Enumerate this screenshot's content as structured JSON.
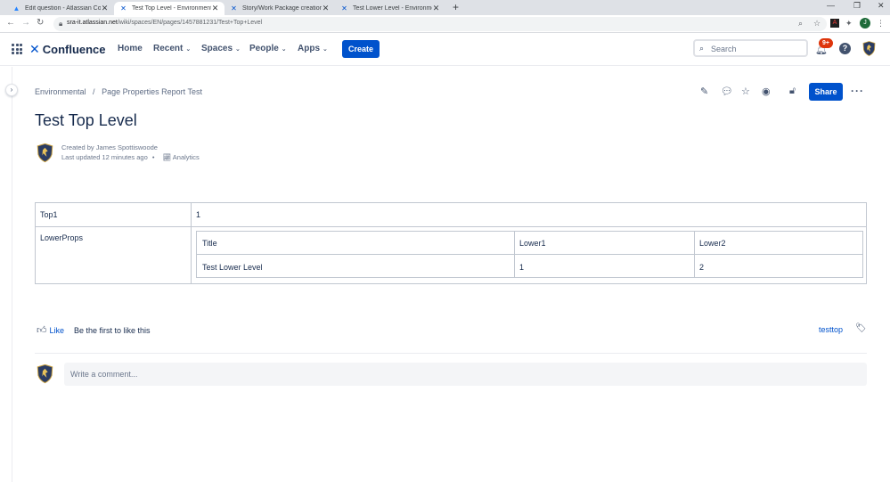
{
  "browser": {
    "tabs": [
      {
        "label": "Edit question - Atlassian Commu...",
        "active": false
      },
      {
        "label": "Test Top Level - Environmental - ...",
        "active": true
      },
      {
        "label": "Story/Work Package creation, ev...",
        "active": false
      },
      {
        "label": "Test Lower Level - Environmenta...",
        "active": false
      }
    ],
    "url_host": "sra-it.atlassian.net",
    "url_path": "/wiki/spaces/EN/pages/1457881231/Test+Top+Level",
    "profile_initial": "J"
  },
  "header": {
    "product": "Confluence",
    "nav": [
      {
        "label": "Home",
        "dropdown": false
      },
      {
        "label": "Recent",
        "dropdown": true
      },
      {
        "label": "Spaces",
        "dropdown": true
      },
      {
        "label": "People",
        "dropdown": true
      },
      {
        "label": "Apps",
        "dropdown": true
      }
    ],
    "create_label": "Create",
    "search_placeholder": "Search",
    "notifications_badge": "9+",
    "brand_color": "#0052cc",
    "badge_color": "#de350b"
  },
  "breadcrumb": [
    "Environmental",
    "Page Properties Report Test"
  ],
  "page": {
    "title": "Test Top Level",
    "created_by": "Created by James Spottiswoode",
    "last_updated": "Last updated 12 minutes ago",
    "bullet": "•",
    "analytics_label": "Analytics",
    "share_label": "Share"
  },
  "properties": {
    "rows": [
      {
        "key": "Top1",
        "value": "1"
      },
      {
        "key": "LowerProps"
      }
    ],
    "inner_table": {
      "headers": [
        "Title",
        "Lower1",
        "Lower2"
      ],
      "rows": [
        [
          "Test Lower Level",
          "1",
          "2"
        ]
      ]
    }
  },
  "footer": {
    "like_label": "Like",
    "like_note": "Be the first to like this",
    "label": "testtop",
    "comment_placeholder": "Write a comment..."
  }
}
